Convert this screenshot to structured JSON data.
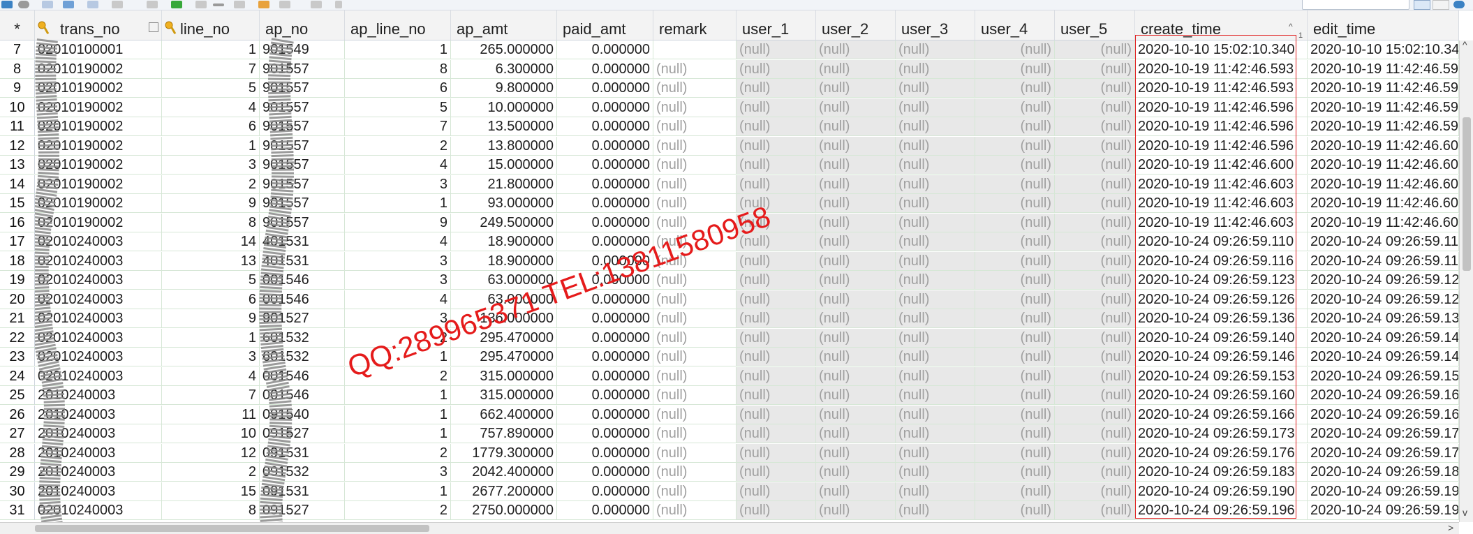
{
  "toolbar": {
    "icons": [
      "refresh-icon",
      "stop-icon",
      "import-icon",
      "grid-icon",
      "form-icon",
      "filter-icon",
      "sort-icon",
      "export-icon",
      "add-icon",
      "delete-icon",
      "minus-icon",
      "edit-icon",
      "commit-icon",
      "rollback-icon",
      "undo-icon"
    ],
    "search_placeholder": ""
  },
  "header": {
    "row_marker": "*",
    "sort_indicator": "1",
    "columns": [
      "trans_no",
      "line_no",
      "ap_no",
      "ap_line_no",
      "ap_amt",
      "paid_amt",
      "remark",
      "user_1",
      "user_2",
      "user_3",
      "user_4",
      "user_5",
      "create_time",
      "edit_time"
    ]
  },
  "rows": [
    {
      "row": "7",
      "trans_no": "02010100001",
      "line_no": "1",
      "ap_no": "901549",
      "ap_line_no": "1",
      "ap_amt": "265.000000",
      "paid_amt": "0.000000",
      "remark": "",
      "user_1": "(null)",
      "user_2": "(null)",
      "user_3": "(null)",
      "user_4": "(null)",
      "user_5": "(null)",
      "create_time": "2020-10-10 15:02:10.340",
      "edit_time": "2020-10-10 15:02:10.34"
    },
    {
      "row": "8",
      "trans_no": "02010190002",
      "line_no": "7",
      "ap_no": "901557",
      "ap_line_no": "8",
      "ap_amt": "6.300000",
      "paid_amt": "0.000000",
      "remark": "(null)",
      "user_1": "(null)",
      "user_2": "(null)",
      "user_3": "(null)",
      "user_4": "(null)",
      "user_5": "(null)",
      "create_time": "2020-10-19 11:42:46.593",
      "edit_time": "2020-10-19 11:42:46.59"
    },
    {
      "row": "9",
      "trans_no": "02010190002",
      "line_no": "5",
      "ap_no": "901557",
      "ap_line_no": "6",
      "ap_amt": "9.800000",
      "paid_amt": "0.000000",
      "remark": "(null)",
      "user_1": "(null)",
      "user_2": "(null)",
      "user_3": "(null)",
      "user_4": "(null)",
      "user_5": "(null)",
      "create_time": "2020-10-19 11:42:46.593",
      "edit_time": "2020-10-19 11:42:46.59"
    },
    {
      "row": "10",
      "trans_no": "02010190002",
      "line_no": "4",
      "ap_no": "901557",
      "ap_line_no": "5",
      "ap_amt": "10.000000",
      "paid_amt": "0.000000",
      "remark": "(null)",
      "user_1": "(null)",
      "user_2": "(null)",
      "user_3": "(null)",
      "user_4": "(null)",
      "user_5": "(null)",
      "create_time": "2020-10-19 11:42:46.596",
      "edit_time": "2020-10-19 11:42:46.59"
    },
    {
      "row": "11",
      "trans_no": "02010190002",
      "line_no": "6",
      "ap_no": "901557",
      "ap_line_no": "7",
      "ap_amt": "13.500000",
      "paid_amt": "0.000000",
      "remark": "(null)",
      "user_1": "(null)",
      "user_2": "(null)",
      "user_3": "(null)",
      "user_4": "(null)",
      "user_5": "(null)",
      "create_time": "2020-10-19 11:42:46.596",
      "edit_time": "2020-10-19 11:42:46.59"
    },
    {
      "row": "12",
      "trans_no": "02010190002",
      "line_no": "1",
      "ap_no": "901557",
      "ap_line_no": "2",
      "ap_amt": "13.800000",
      "paid_amt": "0.000000",
      "remark": "(null)",
      "user_1": "(null)",
      "user_2": "(null)",
      "user_3": "(null)",
      "user_4": "(null)",
      "user_5": "(null)",
      "create_time": "2020-10-19 11:42:46.596",
      "edit_time": "2020-10-19 11:42:46.60"
    },
    {
      "row": "13",
      "trans_no": "02010190002",
      "line_no": "3",
      "ap_no": "901557",
      "ap_line_no": "4",
      "ap_amt": "15.000000",
      "paid_amt": "0.000000",
      "remark": "(null)",
      "user_1": "(null)",
      "user_2": "(null)",
      "user_3": "(null)",
      "user_4": "(null)",
      "user_5": "(null)",
      "create_time": "2020-10-19 11:42:46.600",
      "edit_time": "2020-10-19 11:42:46.60"
    },
    {
      "row": "14",
      "trans_no": "02010190002",
      "line_no": "2",
      "ap_no": "901557",
      "ap_line_no": "3",
      "ap_amt": "21.800000",
      "paid_amt": "0.000000",
      "remark": "(null)",
      "user_1": "(null)",
      "user_2": "(null)",
      "user_3": "(null)",
      "user_4": "(null)",
      "user_5": "(null)",
      "create_time": "2020-10-19 11:42:46.603",
      "edit_time": "2020-10-19 11:42:46.60"
    },
    {
      "row": "15",
      "trans_no": "02010190002",
      "line_no": "9",
      "ap_no": "901557",
      "ap_line_no": "1",
      "ap_amt": "93.000000",
      "paid_amt": "0.000000",
      "remark": "(null)",
      "user_1": "(null)",
      "user_2": "(null)",
      "user_3": "(null)",
      "user_4": "(null)",
      "user_5": "(null)",
      "create_time": "2020-10-19 11:42:46.603",
      "edit_time": "2020-10-19 11:42:46.60"
    },
    {
      "row": "16",
      "trans_no": "02010190002",
      "line_no": "8",
      "ap_no": "901557",
      "ap_line_no": "9",
      "ap_amt": "249.500000",
      "paid_amt": "0.000000",
      "remark": "(null)",
      "user_1": "(null)",
      "user_2": "(null)",
      "user_3": "(null)",
      "user_4": "(null)",
      "user_5": "(null)",
      "create_time": "2020-10-19 11:42:46.603",
      "edit_time": "2020-10-19 11:42:46.60"
    },
    {
      "row": "17",
      "trans_no": "02010240003",
      "line_no": "14",
      "ap_no": "401531",
      "ap_line_no": "4",
      "ap_amt": "18.900000",
      "paid_amt": "0.000000",
      "remark": "(null)",
      "user_1": "(null)",
      "user_2": "(null)",
      "user_3": "(null)",
      "user_4": "(null)",
      "user_5": "(null)",
      "create_time": "2020-10-24 09:26:59.110",
      "edit_time": "2020-10-24 09:26:59.11"
    },
    {
      "row": "18",
      "trans_no": "02010240003",
      "line_no": "13",
      "ap_no": "401531",
      "ap_line_no": "3",
      "ap_amt": "18.900000",
      "paid_amt": "0.000000",
      "remark": "(null)",
      "user_1": "(null)",
      "user_2": "(null)",
      "user_3": "(null)",
      "user_4": "(null)",
      "user_5": "(null)",
      "create_time": "2020-10-24 09:26:59.116",
      "edit_time": "2020-10-24 09:26:59.11"
    },
    {
      "row": "19",
      "trans_no": "02010240003",
      "line_no": "5",
      "ap_no": "001546",
      "ap_line_no": "3",
      "ap_amt": "63.000000",
      "paid_amt": "0.000000",
      "remark": "(null)",
      "user_1": "(null)",
      "user_2": "(null)",
      "user_3": "(null)",
      "user_4": "(null)",
      "user_5": "(null)",
      "create_time": "2020-10-24 09:26:59.123",
      "edit_time": "2020-10-24 09:26:59.12"
    },
    {
      "row": "20",
      "trans_no": "02010240003",
      "line_no": "6",
      "ap_no": "001546",
      "ap_line_no": "4",
      "ap_amt": "63.000000",
      "paid_amt": "0.000000",
      "remark": "(null)",
      "user_1": "(null)",
      "user_2": "(null)",
      "user_3": "(null)",
      "user_4": "(null)",
      "user_5": "(null)",
      "create_time": "2020-10-24 09:26:59.126",
      "edit_time": "2020-10-24 09:26:59.12"
    },
    {
      "row": "21",
      "trans_no": "02010240003",
      "line_no": "9",
      "ap_no": "901527",
      "ap_line_no": "3",
      "ap_amt": "136.000000",
      "paid_amt": "0.000000",
      "remark": "(null)",
      "user_1": "(null)",
      "user_2": "(null)",
      "user_3": "(null)",
      "user_4": "(null)",
      "user_5": "(null)",
      "create_time": "2020-10-24 09:26:59.136",
      "edit_time": "2020-10-24 09:26:59.13"
    },
    {
      "row": "22",
      "trans_no": "02010240003",
      "line_no": "1",
      "ap_no": "601532",
      "ap_line_no": "2",
      "ap_amt": "295.470000",
      "paid_amt": "0.000000",
      "remark": "(null)",
      "user_1": "(null)",
      "user_2": "(null)",
      "user_3": "(null)",
      "user_4": "(null)",
      "user_5": "(null)",
      "create_time": "2020-10-24 09:26:59.140",
      "edit_time": "2020-10-24 09:26:59.14"
    },
    {
      "row": "23",
      "trans_no": "02010240003",
      "line_no": "3",
      "ap_no": "601532",
      "ap_line_no": "1",
      "ap_amt": "295.470000",
      "paid_amt": "0.000000",
      "remark": "(null)",
      "user_1": "(null)",
      "user_2": "(null)",
      "user_3": "(null)",
      "user_4": "(null)",
      "user_5": "(null)",
      "create_time": "2020-10-24 09:26:59.146",
      "edit_time": "2020-10-24 09:26:59.14"
    },
    {
      "row": "24",
      "trans_no": "02010240003",
      "line_no": "4",
      "ap_no": "001546",
      "ap_line_no": "2",
      "ap_amt": "315.000000",
      "paid_amt": "0.000000",
      "remark": "(null)",
      "user_1": "(null)",
      "user_2": "(null)",
      "user_3": "(null)",
      "user_4": "(null)",
      "user_5": "(null)",
      "create_time": "2020-10-24 09:26:59.153",
      "edit_time": "2020-10-24 09:26:59.15"
    },
    {
      "row": "25",
      "trans_no": "2010240003",
      "line_no": "7",
      "ap_no": "001546",
      "ap_line_no": "1",
      "ap_amt": "315.000000",
      "paid_amt": "0.000000",
      "remark": "(null)",
      "user_1": "(null)",
      "user_2": "(null)",
      "user_3": "(null)",
      "user_4": "(null)",
      "user_5": "(null)",
      "create_time": "2020-10-24 09:26:59.160",
      "edit_time": "2020-10-24 09:26:59.16"
    },
    {
      "row": "26",
      "trans_no": "2010240003",
      "line_no": "11",
      "ap_no": "091540",
      "ap_line_no": "1",
      "ap_amt": "662.400000",
      "paid_amt": "0.000000",
      "remark": "(null)",
      "user_1": "(null)",
      "user_2": "(null)",
      "user_3": "(null)",
      "user_4": "(null)",
      "user_5": "(null)",
      "create_time": "2020-10-24 09:26:59.166",
      "edit_time": "2020-10-24 09:26:59.16"
    },
    {
      "row": "27",
      "trans_no": "2010240003",
      "line_no": "10",
      "ap_no": "091527",
      "ap_line_no": "1",
      "ap_amt": "757.890000",
      "paid_amt": "0.000000",
      "remark": "(null)",
      "user_1": "(null)",
      "user_2": "(null)",
      "user_3": "(null)",
      "user_4": "(null)",
      "user_5": "(null)",
      "create_time": "2020-10-24 09:26:59.173",
      "edit_time": "2020-10-24 09:26:59.17"
    },
    {
      "row": "28",
      "trans_no": "2010240003",
      "line_no": "12",
      "ap_no": "091531",
      "ap_line_no": "2",
      "ap_amt": "1779.300000",
      "paid_amt": "0.000000",
      "remark": "(null)",
      "user_1": "(null)",
      "user_2": "(null)",
      "user_3": "(null)",
      "user_4": "(null)",
      "user_5": "(null)",
      "create_time": "2020-10-24 09:26:59.176",
      "edit_time": "2020-10-24 09:26:59.17"
    },
    {
      "row": "29",
      "trans_no": "2010240003",
      "line_no": "2",
      "ap_no": "091532",
      "ap_line_no": "3",
      "ap_amt": "2042.400000",
      "paid_amt": "0.000000",
      "remark": "(null)",
      "user_1": "(null)",
      "user_2": "(null)",
      "user_3": "(null)",
      "user_4": "(null)",
      "user_5": "(null)",
      "create_time": "2020-10-24 09:26:59.183",
      "edit_time": "2020-10-24 09:26:59.18"
    },
    {
      "row": "30",
      "trans_no": "2010240003",
      "line_no": "15",
      "ap_no": "091531",
      "ap_line_no": "1",
      "ap_amt": "2677.200000",
      "paid_amt": "0.000000",
      "remark": "(null)",
      "user_1": "(null)",
      "user_2": "(null)",
      "user_3": "(null)",
      "user_4": "(null)",
      "user_5": "(null)",
      "create_time": "2020-10-24 09:26:59.190",
      "edit_time": "2020-10-24 09:26:59.19"
    },
    {
      "row": "31",
      "trans_no": "02010240003",
      "line_no": "8",
      "ap_no": "091527",
      "ap_line_no": "2",
      "ap_amt": "2750.000000",
      "paid_amt": "0.000000",
      "remark": "(null)",
      "user_1": "(null)",
      "user_2": "(null)",
      "user_3": "(null)",
      "user_4": "(null)",
      "user_5": "(null)",
      "create_time": "2020-10-24 09:26:59.196",
      "edit_time": "2020-10-24 09:26:59.19"
    }
  ],
  "watermark": "QQ:289965371  TEL:13811580958",
  "colors": {
    "grid_line": "#d6e7d6",
    "null_text": "#a0a0a0",
    "null_bg": "#e8e8e8",
    "highlight_box": "#e02020",
    "watermark": "#e51b1b"
  }
}
